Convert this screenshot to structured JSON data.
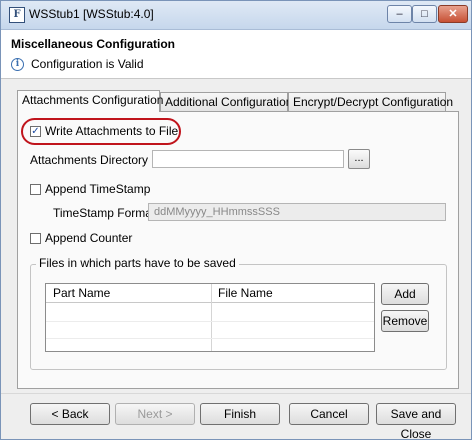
{
  "window": {
    "app_icon_glyph": "F",
    "title": "WSStub1 [WSStub:4.0]",
    "minimize_glyph": "–",
    "maximize_glyph": "□",
    "close_glyph": "✕"
  },
  "header": {
    "title": "Miscellaneous Configuration",
    "info_icon_glyph": "i",
    "status_message": "Configuration is Valid"
  },
  "tabs": [
    {
      "label": "Attachments Configuration",
      "active": true
    },
    {
      "label": "Additional Configuration",
      "active": false
    },
    {
      "label": "Encrypt/Decrypt Configuration",
      "active": false
    }
  ],
  "form": {
    "write_attachments": {
      "label": "Write Attachments to File",
      "checked": true,
      "check_glyph": "✓"
    },
    "attachments_directory": {
      "label": "Attachments Directory",
      "value": "",
      "browse_label": "..."
    },
    "append_timestamp": {
      "label": "Append TimeStamp",
      "checked": false
    },
    "timestamp_format": {
      "label": "TimeStamp Format",
      "value": "ddMMyyyy_HHmmssSSS"
    },
    "append_counter": {
      "label": "Append Counter",
      "checked": false
    }
  },
  "files_group": {
    "legend": "Files in which parts have to be saved",
    "columns": [
      "Part Name",
      "File Name"
    ],
    "rows": [],
    "add_label": "Add",
    "remove_label": "Remove"
  },
  "footer": {
    "back_label": "< Back",
    "next_label": "Next >",
    "finish_label": "Finish",
    "cancel_label": "Cancel",
    "save_close_label": "Save and Close"
  },
  "colors": {
    "highlight_ring": "#c0141c",
    "titlebar": "#c6d7ec",
    "close_button": "#c75034"
  }
}
